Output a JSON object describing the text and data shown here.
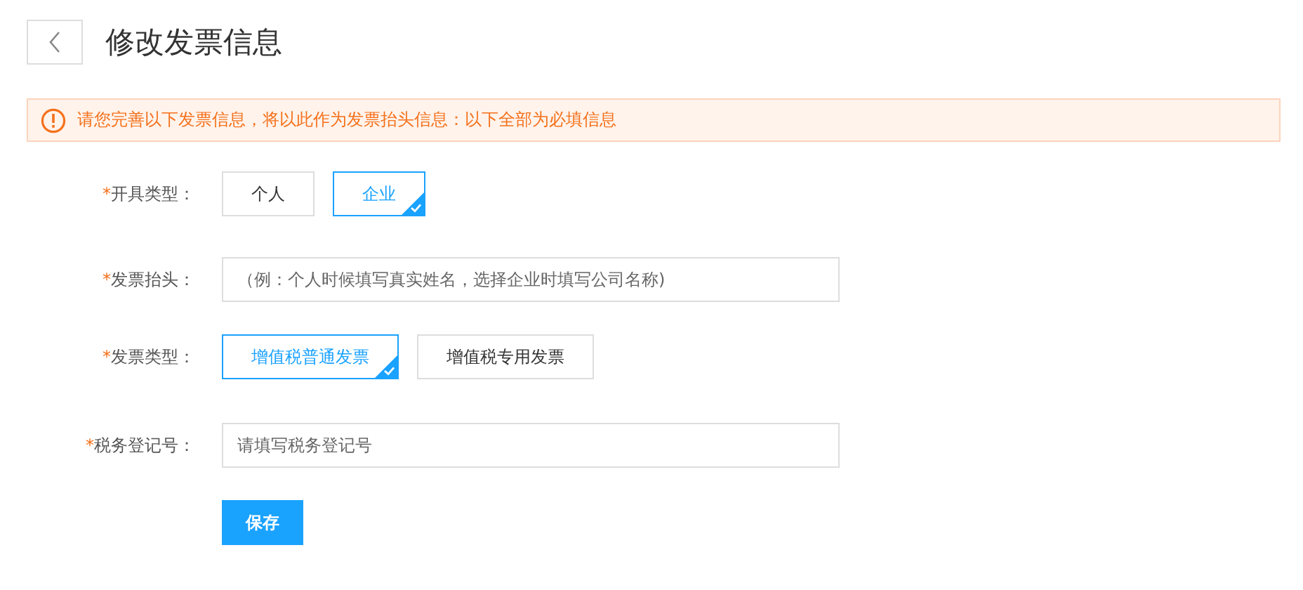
{
  "header": {
    "title": "修改发票信息"
  },
  "alert": {
    "message": "请您完善以下发票信息，将以此作为发票抬头信息：以下全部为必填信息"
  },
  "fields": [
    {
      "kind": "options",
      "required_mark": "*",
      "label": "开具类型：",
      "options": [
        {
          "label": "个人",
          "selected": false
        },
        {
          "label": "企业",
          "selected": true
        }
      ]
    },
    {
      "kind": "input",
      "required_mark": "*",
      "label": "发票抬头：",
      "placeholder": "（例：个人时候填写真实姓名，选择企业时填写公司名称)"
    },
    {
      "kind": "options",
      "required_mark": "*",
      "label": "发票类型：",
      "options": [
        {
          "label": "增值税普通发票",
          "selected": true
        },
        {
          "label": "增值税专用发票",
          "selected": false
        }
      ]
    },
    {
      "kind": "input",
      "required_mark": "*",
      "label": "税务登记号：",
      "placeholder": "请填写税务登记号"
    }
  ],
  "save_button": "保存"
}
